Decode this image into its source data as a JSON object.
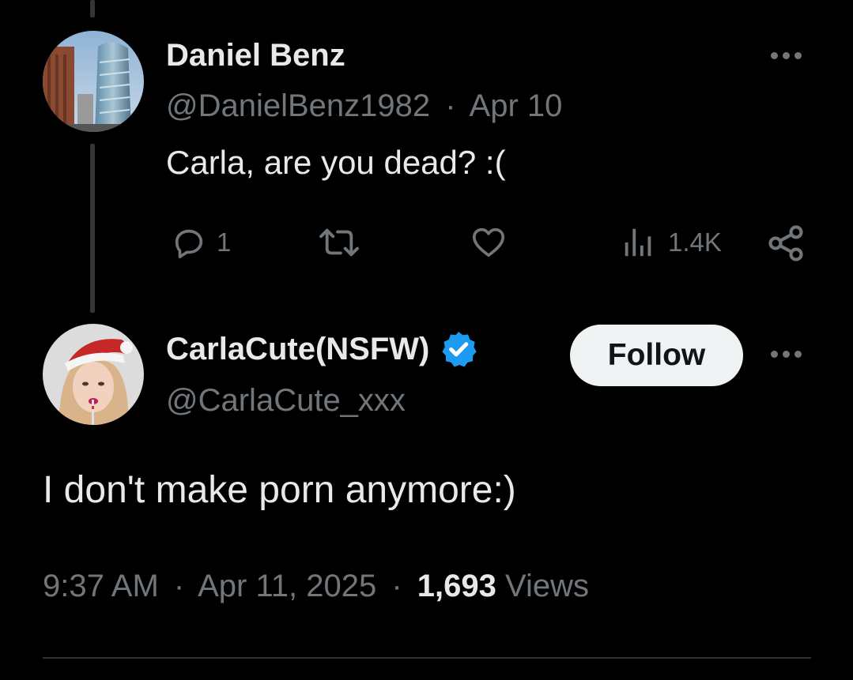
{
  "parent_tweet": {
    "display_name": "Daniel Benz",
    "handle": "@DanielBenz1982",
    "separator": "·",
    "date": "Apr 10",
    "text": "Carla, are you dead? :(",
    "actions": {
      "reply_count": "1",
      "views_count": "1.4K"
    },
    "icons": {
      "avatar": "city-skyscraper-avatar",
      "more": "more-icon",
      "reply": "reply-icon",
      "retweet": "retweet-icon",
      "like": "heart-icon",
      "views": "views-icon",
      "share": "share-icon"
    }
  },
  "main_tweet": {
    "display_name": "CarlaCute(NSFW)",
    "handle": "@CarlaCute_xxx",
    "follow_label": "Follow",
    "text": "I don't make porn anymore:)",
    "time": "9:37 AM",
    "separator": "·",
    "date": "Apr 11, 2025",
    "views_count": "1,693",
    "views_label": "Views",
    "icons": {
      "avatar": "woman-santa-hat-avatar",
      "verified": "verified-badge-icon",
      "more": "more-icon"
    }
  },
  "colors": {
    "background": "#000000",
    "primary_text": "#e7e9ea",
    "muted_text": "#71767b",
    "verified_blue": "#1d9bf0",
    "follow_button_bg": "#eff3f4",
    "thread_line": "#333639"
  }
}
